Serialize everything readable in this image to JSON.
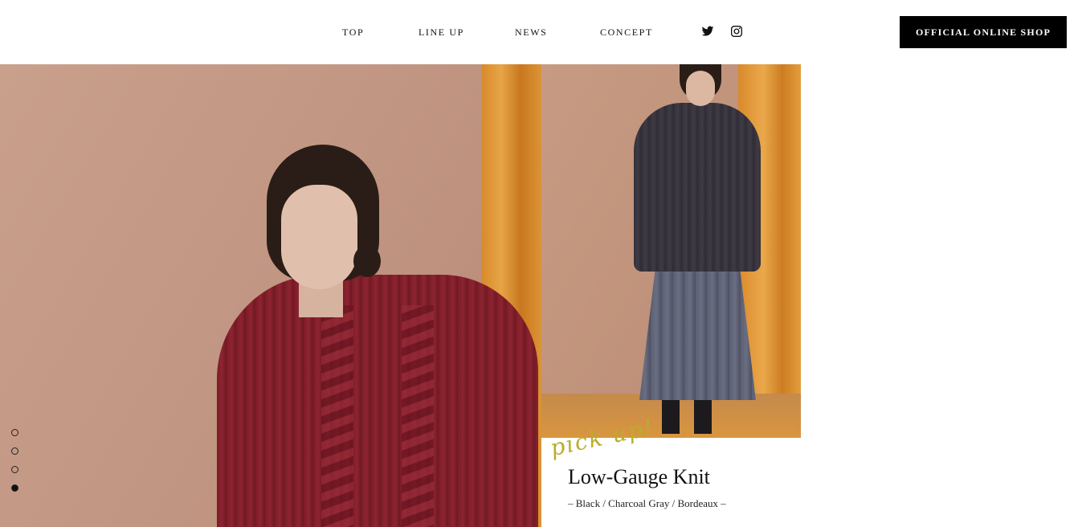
{
  "nav": {
    "items": [
      {
        "label": "TOP"
      },
      {
        "label": "LINE UP"
      },
      {
        "label": "NEWS"
      },
      {
        "label": "CONCEPT"
      }
    ],
    "social": [
      {
        "icon": "twitter-icon"
      },
      {
        "icon": "instagram-icon"
      }
    ],
    "shop_button": "OFFICIAL ONLINE SHOP"
  },
  "hero": {
    "image": "model-burgundy-cable-knit-photo",
    "slider": {
      "count": 4,
      "active_index": 3
    }
  },
  "pickup": {
    "script_label": "pick up!",
    "image": "model-charcoal-knit-pleated-skirt-photo",
    "title": "Low-Gauge Knit",
    "colors": "– Black / Charcoal Gray / Bordeaux –"
  },
  "colors": {
    "accent_script": "#b9ad2c",
    "button_bg": "#000000",
    "button_text": "#ffffff"
  }
}
